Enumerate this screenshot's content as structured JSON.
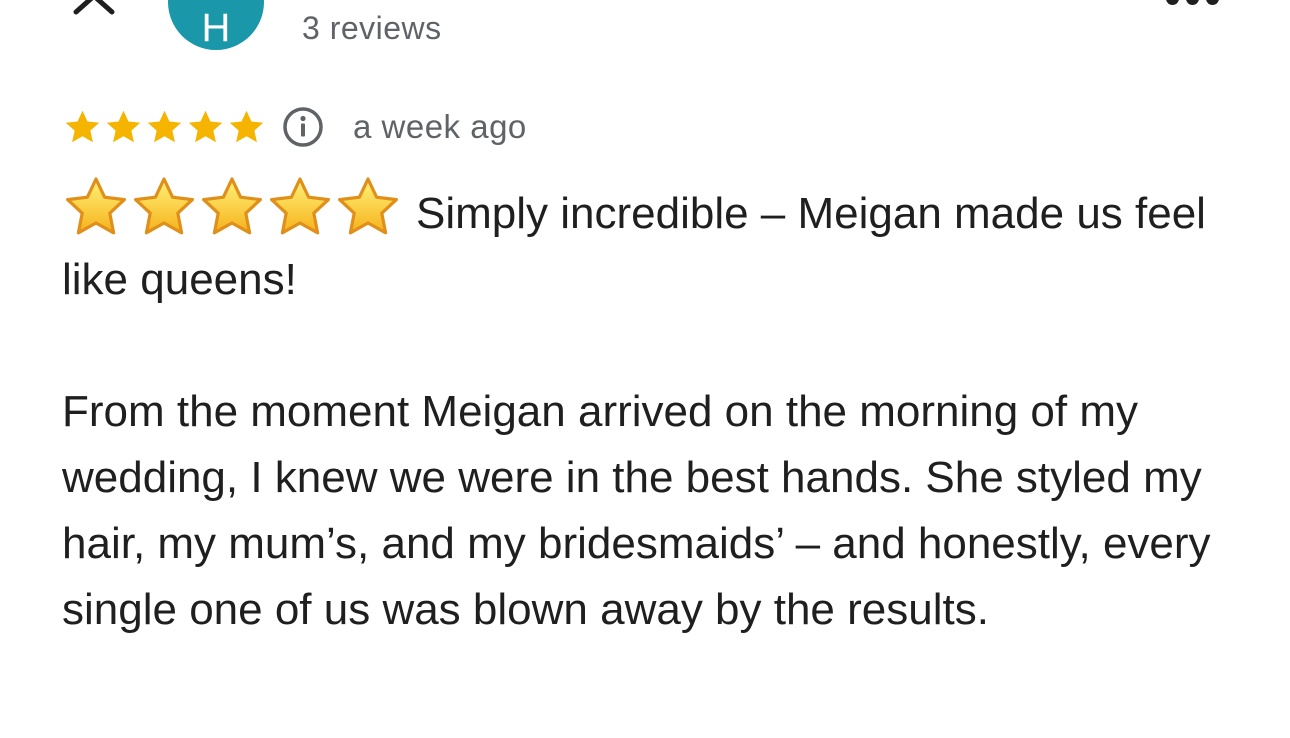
{
  "header": {
    "avatar_letter": "H",
    "reviews_count": "3 reviews"
  },
  "rating": {
    "value": 5,
    "max": 5,
    "star_color": "#f4b400",
    "date": "a week ago"
  },
  "review": {
    "headline": "Simply incredible – Meigan made us feel like queens!",
    "body": "From the moment Meigan arrived on the morning of my wedding, I knew we were in the best hands. She styled my hair, my mum’s, and my bridesmaids’ – and honestly, every single one of us was blown away by the results."
  },
  "icons": {
    "close": "close-icon",
    "more": "more-vert-icon",
    "info": "info-icon",
    "star": "star-icon",
    "emoji_star": "emoji-star-icon"
  },
  "colors": {
    "avatar_bg": "#1a97a8",
    "secondary_text": "#5f6368",
    "primary_text": "#1f1f1f"
  }
}
